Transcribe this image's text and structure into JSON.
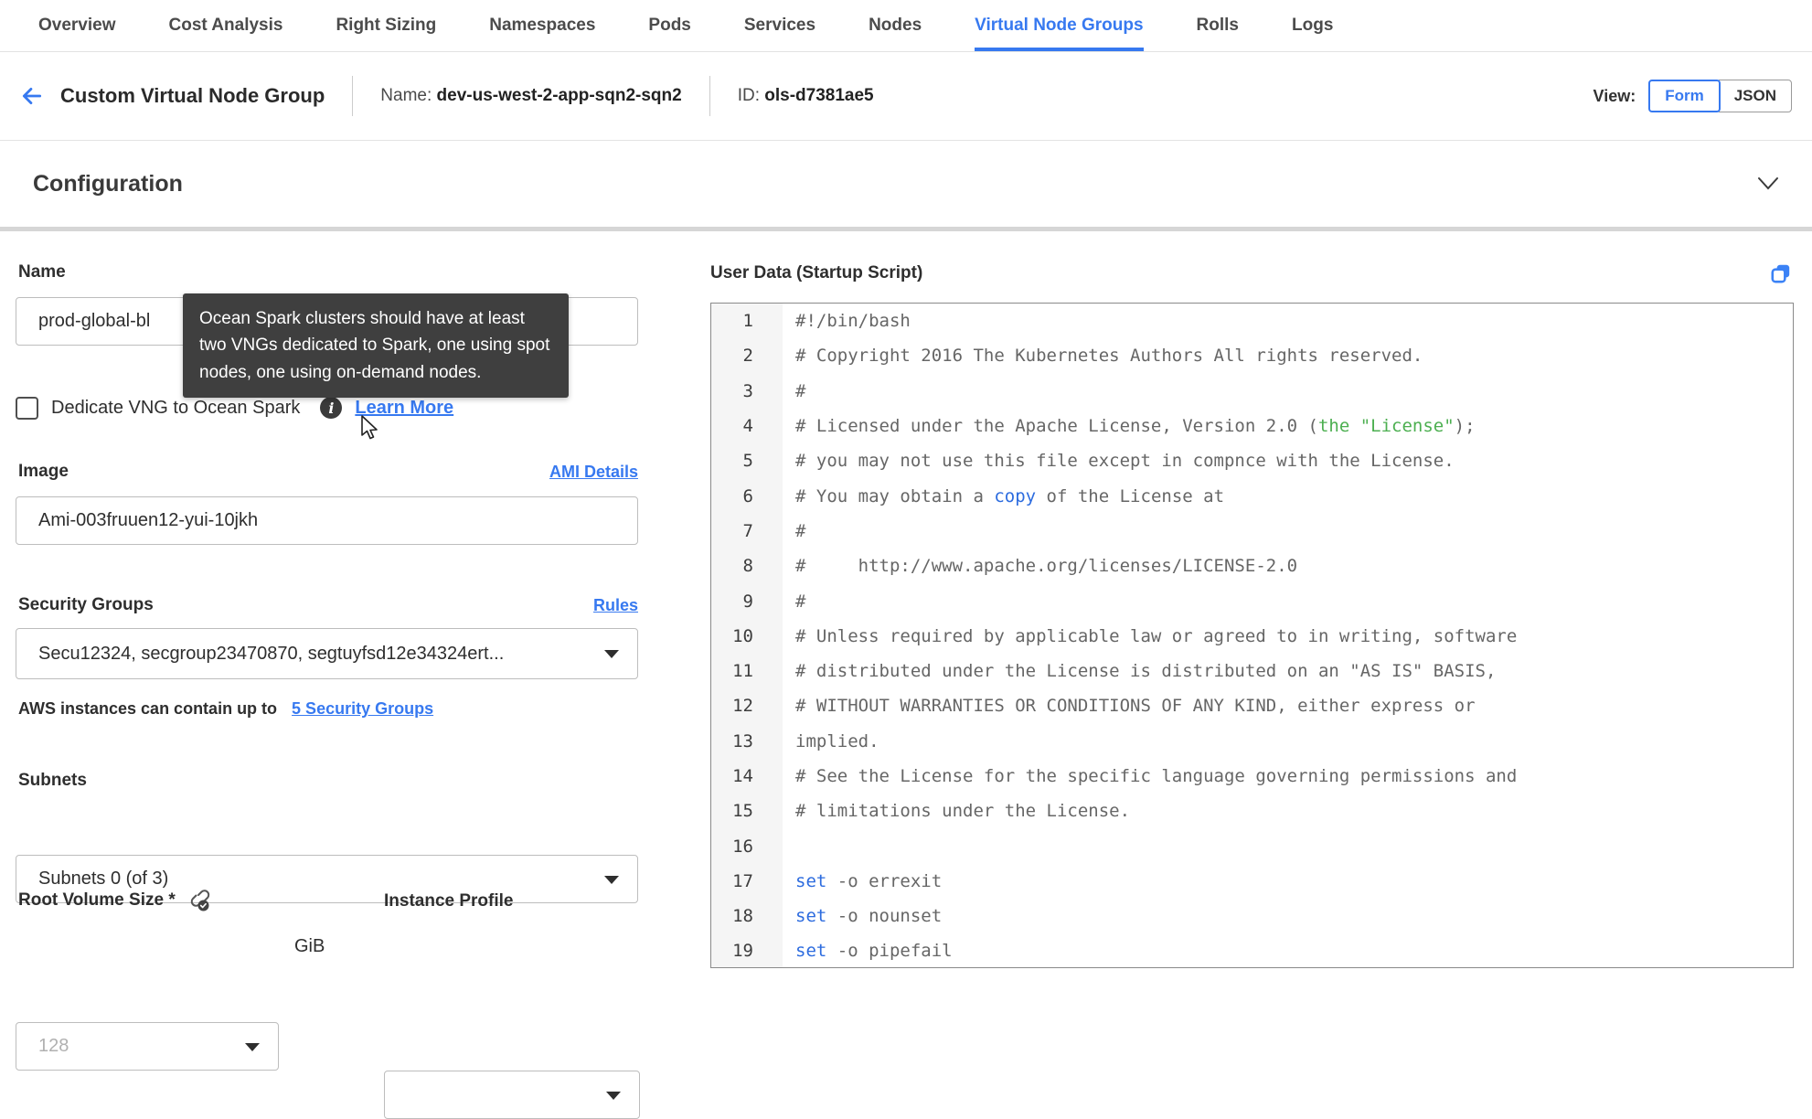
{
  "colors": {
    "accent": "#3779f0",
    "tooltip_bg": "#3f3f3f",
    "code_comment": "#666666",
    "code_green": "#4caf50",
    "code_keyword_blue": "#2d6cdf",
    "copy_icon_blue": "#3b82f6",
    "text_dark": "#2e2e2e",
    "border_input": "#bdbdbd",
    "editor_border": "#8a8a8a",
    "gutter_bg": "#f5f5f5"
  },
  "tabs": {
    "items": [
      {
        "label": "Overview",
        "active": false
      },
      {
        "label": "Cost Analysis",
        "active": false
      },
      {
        "label": "Right Sizing",
        "active": false
      },
      {
        "label": "Namespaces",
        "active": false
      },
      {
        "label": "Pods",
        "active": false
      },
      {
        "label": "Services",
        "active": false
      },
      {
        "label": "Nodes",
        "active": false
      },
      {
        "label": "Virtual Node Groups",
        "active": true
      },
      {
        "label": "Rolls",
        "active": false
      },
      {
        "label": "Logs",
        "active": false
      }
    ]
  },
  "header": {
    "title": "Custom Virtual Node Group",
    "name_label": "Name:",
    "name_value": "dev-us-west-2-app-sqn2-sqn2",
    "id_label": "ID:",
    "id_value": "ols-d7381ae5",
    "view_label": "View:",
    "view_form": "Form",
    "view_json": "JSON"
  },
  "config_section": {
    "title": "Configuration"
  },
  "form": {
    "name": {
      "label": "Name",
      "value": "prod-global-bl"
    },
    "tooltip": {
      "text": "Ocean Spark clusters should have at least two VNGs dedicated to Spark, one using spot nodes, one using on-demand nodes."
    },
    "dedicate": {
      "label": "Dedicate VNG to Ocean Spark",
      "info_glyph": "i",
      "link": "Learn More"
    },
    "image": {
      "label": "Image",
      "link": "AMI Details",
      "value": "Ami-003fruuen12-yui-10jkh"
    },
    "security_groups": {
      "label": "Security Groups",
      "link": "Rules",
      "value": "Secu12324, secgroup23470870, segtuyfsd12e34324ert...",
      "helper_text": "AWS instances can contain up to",
      "helper_link": "5 Security Groups"
    },
    "subnets": {
      "label": "Subnets",
      "value": "Subnets 0 (of 3)"
    },
    "root_volume": {
      "label": "Root Volume Size *",
      "placeholder": "128",
      "unit": "GiB"
    },
    "instance_profile": {
      "label": "Instance Profile",
      "value": ""
    }
  },
  "editor": {
    "title": "User Data (Startup Script)",
    "lines": [
      {
        "n": 1,
        "seg": [
          {
            "c": "d",
            "t": "#!/bin/bash"
          }
        ]
      },
      {
        "n": 2,
        "seg": [
          {
            "c": "d",
            "t": "# Copyright 2016 The Kubernetes Authors All rights reserved."
          }
        ]
      },
      {
        "n": 3,
        "seg": [
          {
            "c": "d",
            "t": "#"
          }
        ]
      },
      {
        "n": 4,
        "seg": [
          {
            "c": "d",
            "t": "# Licensed under the Apache License, Version 2.0 ("
          },
          {
            "c": "gr",
            "t": "the \"License\""
          },
          {
            "c": "d",
            "t": ");"
          }
        ]
      },
      {
        "n": 5,
        "seg": [
          {
            "c": "d",
            "t": "# you may not use this file except in compnce with the License."
          }
        ]
      },
      {
        "n": 6,
        "seg": [
          {
            "c": "d",
            "t": "# You may obtain a "
          },
          {
            "c": "bl",
            "t": "copy"
          },
          {
            "c": "d",
            "t": " of the License at"
          }
        ]
      },
      {
        "n": 7,
        "seg": [
          {
            "c": "d",
            "t": "#"
          }
        ]
      },
      {
        "n": 8,
        "seg": [
          {
            "c": "d",
            "t": "#     http://www.apache.org/licenses/LICENSE-2.0"
          }
        ]
      },
      {
        "n": 9,
        "seg": [
          {
            "c": "d",
            "t": "#"
          }
        ]
      },
      {
        "n": 10,
        "seg": [
          {
            "c": "d",
            "t": "# Unless required by applicable law or agreed to in writing, software"
          }
        ]
      },
      {
        "n": 11,
        "seg": [
          {
            "c": "d",
            "t": "# distributed under the License is distributed on an \"AS IS\" BASIS,"
          }
        ]
      },
      {
        "n": 12,
        "seg": [
          {
            "c": "d",
            "t": "# WITHOUT WARRANTIES OR CONDITIONS OF ANY KIND, either express or"
          }
        ]
      },
      {
        "n": 13,
        "seg": [
          {
            "c": "d",
            "t": "implied."
          }
        ]
      },
      {
        "n": 14,
        "seg": [
          {
            "c": "d",
            "t": "# See the License for the specific language governing permissions and"
          }
        ]
      },
      {
        "n": 15,
        "seg": [
          {
            "c": "d",
            "t": "# limitations under the License."
          }
        ]
      },
      {
        "n": 16,
        "seg": []
      },
      {
        "n": 17,
        "seg": [
          {
            "c": "bl",
            "t": "set"
          },
          {
            "c": "d",
            "t": " -o errexit"
          }
        ]
      },
      {
        "n": 18,
        "seg": [
          {
            "c": "bl",
            "t": "set"
          },
          {
            "c": "d",
            "t": " -o nounset"
          }
        ]
      },
      {
        "n": 19,
        "seg": [
          {
            "c": "bl",
            "t": "set"
          },
          {
            "c": "d",
            "t": " -o pipefail"
          }
        ]
      }
    ]
  }
}
